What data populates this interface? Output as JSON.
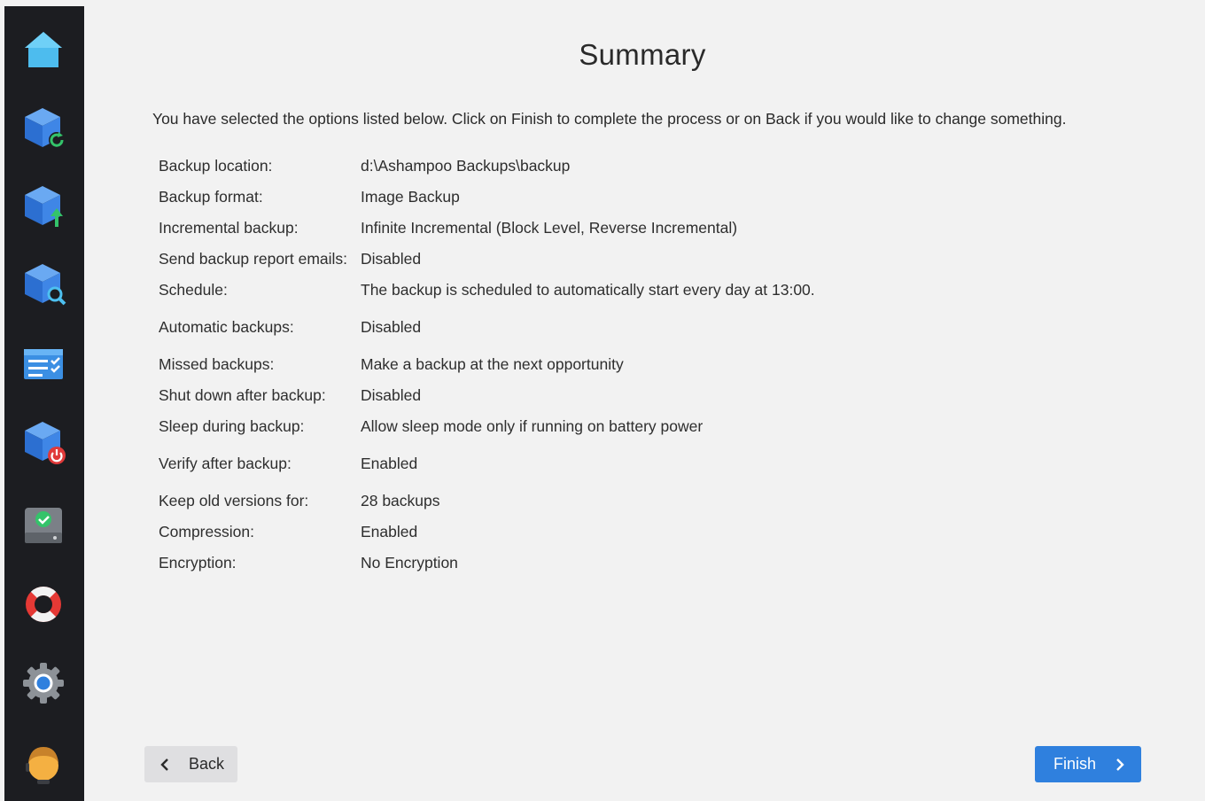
{
  "sidebar": {
    "items": [
      {
        "name": "home",
        "icon": "home-icon"
      },
      {
        "name": "backup-restore",
        "icon": "cube-refresh-icon"
      },
      {
        "name": "backup-upload",
        "icon": "cube-upload-icon"
      },
      {
        "name": "backup-search",
        "icon": "cube-search-icon"
      },
      {
        "name": "task-list",
        "icon": "checklist-icon"
      },
      {
        "name": "backup-power",
        "icon": "cube-power-icon"
      },
      {
        "name": "drive-check",
        "icon": "drive-check-icon"
      },
      {
        "name": "help",
        "icon": "lifebuoy-icon"
      },
      {
        "name": "settings",
        "icon": "gear-icon"
      },
      {
        "name": "account",
        "icon": "avatar-icon"
      }
    ]
  },
  "main": {
    "title": "Summary",
    "intro": "You have selected the options listed below. Click on Finish to complete the process or on Back if you would like to change something.",
    "rows": [
      {
        "label": "Backup location:",
        "value": "d:\\Ashampoo Backups\\backup"
      },
      {
        "label": "Backup format:",
        "value": "Image Backup"
      },
      {
        "label": "Incremental backup:",
        "value": "Infinite Incremental (Block Level, Reverse Incremental)"
      },
      {
        "label": "Send backup report emails:",
        "value": "Disabled"
      },
      {
        "label": "Schedule:",
        "value": "The backup is scheduled to automatically start every day at 13:00."
      },
      {
        "label": "Automatic backups:",
        "value": "Disabled"
      },
      {
        "label": "Missed backups:",
        "value": "Make a backup at the next opportunity"
      },
      {
        "label": "Shut down after backup:",
        "value": "Disabled"
      },
      {
        "label": "Sleep during backup:",
        "value": "Allow sleep mode only if running on battery power"
      },
      {
        "label": "Verify after backup:",
        "value": "Enabled"
      },
      {
        "label": "Keep old versions for:",
        "value": "28 backups"
      },
      {
        "label": "Compression:",
        "value": "Enabled"
      },
      {
        "label": "Encryption:",
        "value": "No Encryption"
      }
    ]
  },
  "footer": {
    "back_label": "Back",
    "finish_label": "Finish"
  },
  "colors": {
    "sidebar_bg": "#1c1d21",
    "content_bg": "#f2f2f2",
    "accent": "#2f80de",
    "back_button_bg": "#dfdfe1"
  }
}
